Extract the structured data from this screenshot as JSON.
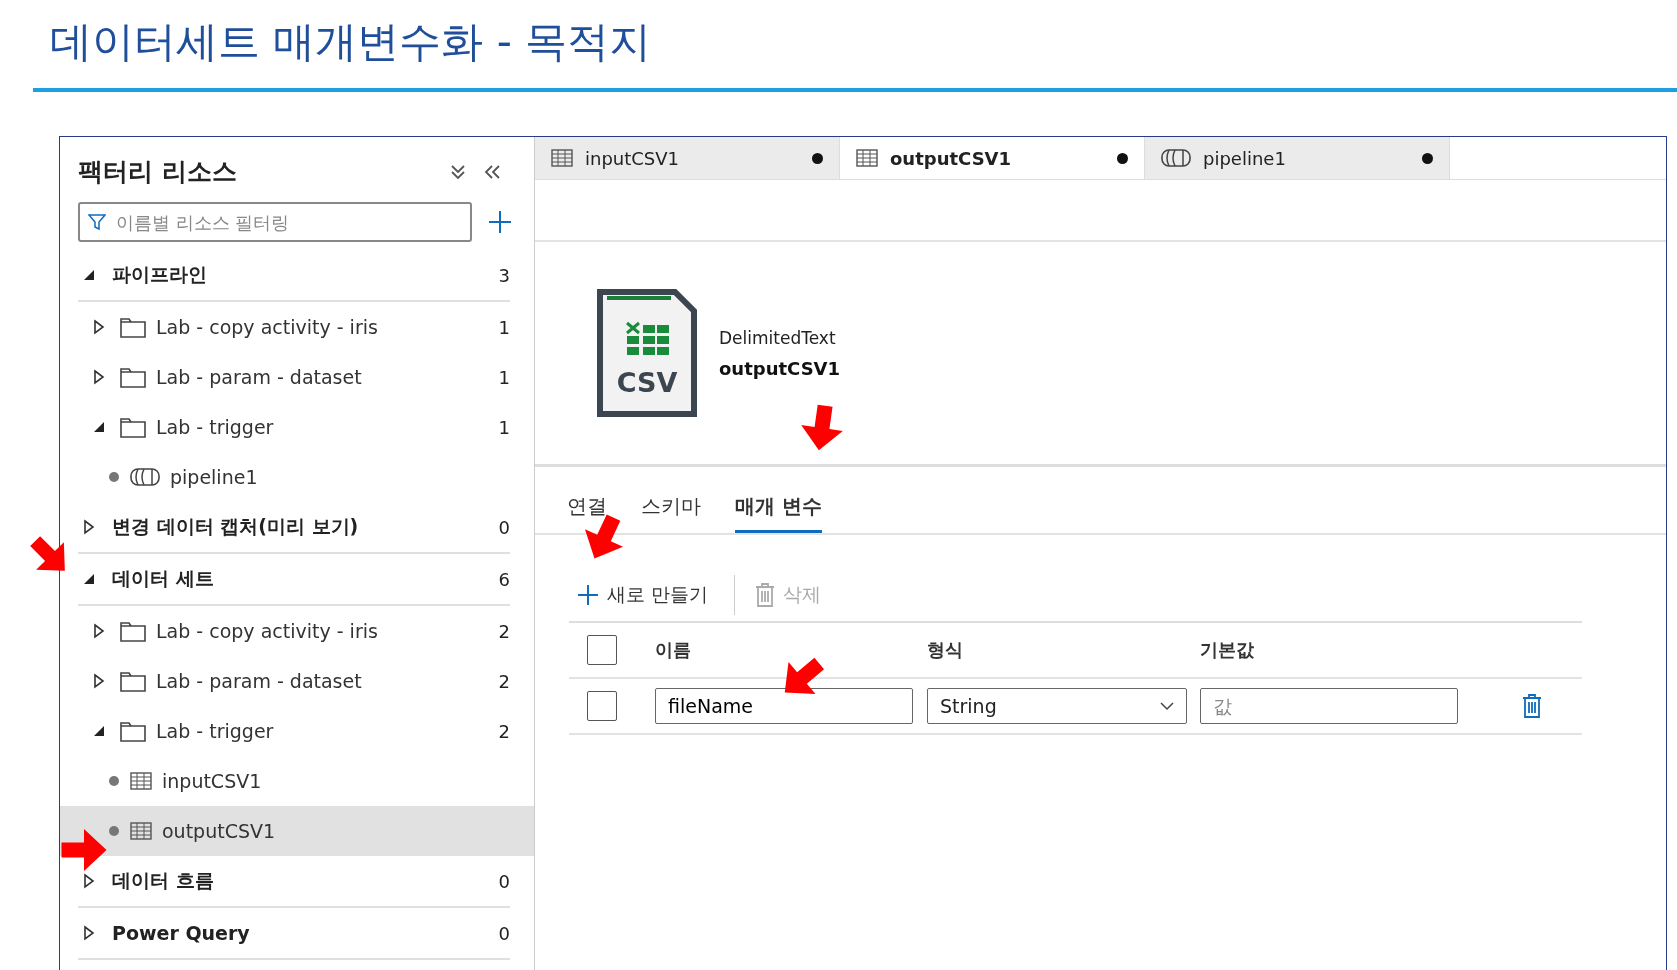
{
  "slide_title": "데이터세트 매개변수화 - 목적지",
  "sidebar": {
    "title": "팩터리 리소스",
    "filter": {
      "placeholder": "이름별 리소스 필터링"
    },
    "sections": [
      {
        "label": "파이프라인",
        "count": "3",
        "expanded": true,
        "children": [
          {
            "kind": "folder",
            "label": "Lab - copy activity - iris",
            "count": "1",
            "expanded": false
          },
          {
            "kind": "folder",
            "label": "Lab - param - dataset",
            "count": "1",
            "expanded": false
          },
          {
            "kind": "folder",
            "label": "Lab - trigger",
            "count": "1",
            "expanded": true,
            "children": [
              {
                "kind": "pipeline",
                "label": "pipeline1",
                "selected": false
              }
            ]
          }
        ]
      },
      {
        "label": "변경 데이터 캡처(미리 보기)",
        "count": "0",
        "expanded": false
      },
      {
        "label": "데이터 세트",
        "count": "6",
        "expanded": true,
        "children": [
          {
            "kind": "folder",
            "label": "Lab - copy activity - iris",
            "count": "2",
            "expanded": false
          },
          {
            "kind": "folder",
            "label": "Lab - param - dataset",
            "count": "2",
            "expanded": false
          },
          {
            "kind": "folder",
            "label": "Lab - trigger",
            "count": "2",
            "expanded": true,
            "children": [
              {
                "kind": "dataset",
                "label": "inputCSV1",
                "selected": false
              },
              {
                "kind": "dataset",
                "label": "outputCSV1",
                "selected": true
              }
            ]
          }
        ]
      },
      {
        "label": "데이터 흐름",
        "count": "0",
        "expanded": false
      },
      {
        "label": "Power Query",
        "count": "0",
        "expanded": false
      }
    ]
  },
  "editor_tabs": [
    {
      "kind": "dataset",
      "label": "inputCSV1",
      "selected": false,
      "unsaved": true
    },
    {
      "kind": "dataset",
      "label": "outputCSV1",
      "selected": true,
      "unsaved": true
    },
    {
      "kind": "pipeline",
      "label": "pipeline1",
      "selected": false,
      "unsaved": true
    }
  ],
  "dataset": {
    "type": "DelimitedText",
    "name": "outputCSV1",
    "icon_label": "CSV"
  },
  "property_tabs": [
    {
      "label": "연결",
      "selected": false
    },
    {
      "label": "스키마",
      "selected": false
    },
    {
      "label": "매개 변수",
      "selected": true
    }
  ],
  "toolbar": [
    {
      "kind": "new",
      "label": "새로 만들기",
      "disabled": false
    },
    {
      "kind": "delete",
      "label": "삭제",
      "disabled": true
    }
  ],
  "parameters": {
    "select_all": false,
    "columns": [
      "이름",
      "형식",
      "기본값"
    ],
    "rows": [
      {
        "checked": false,
        "name": "fileName",
        "type": "String",
        "default": {
          "placeholder": "값"
        }
      }
    ]
  }
}
